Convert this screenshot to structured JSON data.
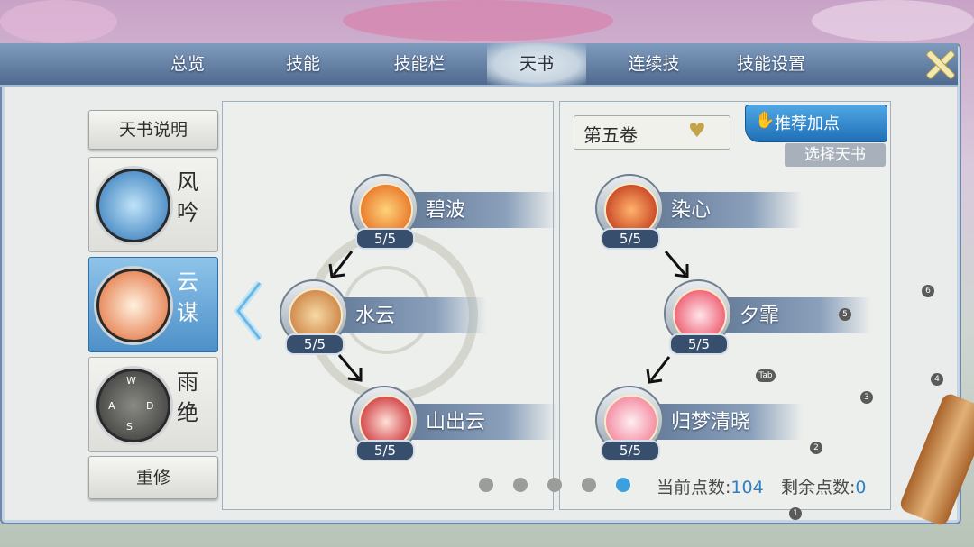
{
  "tabs": [
    {
      "label": "总览",
      "active": false
    },
    {
      "label": "技能",
      "active": false
    },
    {
      "label": "技能栏",
      "active": false
    },
    {
      "label": "天书",
      "active": true
    },
    {
      "label": "连续技",
      "active": false
    },
    {
      "label": "技能设置",
      "active": false
    }
  ],
  "sidebar": {
    "info_button": "天书说明",
    "schools": [
      {
        "name": "风吟",
        "active": false
      },
      {
        "name": "云谋",
        "active": true
      },
      {
        "name": "雨绝",
        "active": false
      }
    ],
    "reset_button": "重修",
    "compass": [
      "W",
      "A",
      "D",
      "S"
    ]
  },
  "left_tree": [
    {
      "name": "碧波",
      "level": "5/5"
    },
    {
      "name": "水云",
      "level": "5/5"
    },
    {
      "name": "山出云",
      "level": "5/5"
    }
  ],
  "right_panel": {
    "volume_select": "第五卷",
    "recommend_button": "推荐加点",
    "choose_book": "选择天书",
    "tree": [
      {
        "name": "染心",
        "level": "5/5"
      },
      {
        "name": "夕霏",
        "level": "5/5"
      },
      {
        "name": "归梦清晓",
        "level": "5/5"
      }
    ]
  },
  "pager": {
    "count": 5,
    "active_index": 4
  },
  "points": {
    "current_label": "当前点数:",
    "current_value": "104",
    "remaining_label": "剩余点数:",
    "remaining_value": "0"
  },
  "overlay_badges": [
    "6",
    "5",
    "Tab",
    "4",
    "3",
    "2",
    "1"
  ],
  "colors": {
    "accent_blue": "#3d9fdc",
    "tab_bar": "#5f7ca2"
  }
}
